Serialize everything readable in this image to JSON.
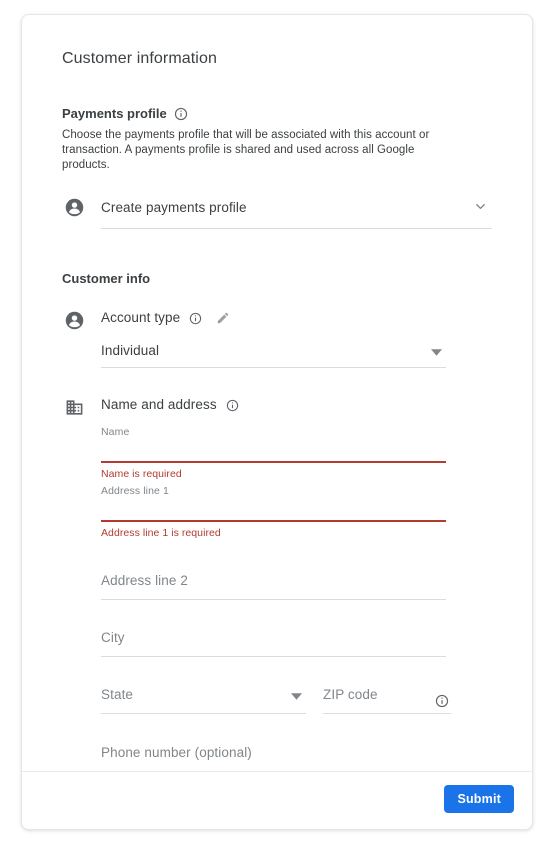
{
  "card": {
    "title": "Customer information",
    "payments_profile": {
      "heading": "Payments profile",
      "info_icon": "info-icon",
      "description": "Choose the payments profile that will be associated with this account or transaction. A payments profile is shared and used across all Google products.",
      "select": {
        "leading_icon": "account-circle-icon",
        "value": "Create payments profile",
        "chevron_icon": "chevron-down-icon"
      }
    },
    "customer_info": {
      "heading": "Customer info",
      "account_type": {
        "leading_icon": "account-circle-icon",
        "label": "Account type",
        "info_icon": "info-icon",
        "edit_icon": "pencil-icon",
        "value": "Individual",
        "dropdown_icon": "dropdown-arrow-icon"
      },
      "name_and_address": {
        "leading_icon": "building-icon",
        "label": "Name and address",
        "info_icon": "info-icon",
        "fields": {
          "name": {
            "label": "Name",
            "value": "",
            "error": "Name is required"
          },
          "address_line_1": {
            "label": "Address line 1",
            "value": "",
            "error": "Address line 1 is required"
          },
          "address_line_2": {
            "placeholder": "Address line 2",
            "value": ""
          },
          "city": {
            "placeholder": "City",
            "value": ""
          },
          "state": {
            "placeholder": "State",
            "value": "",
            "dropdown_icon": "dropdown-arrow-icon"
          },
          "zip_code": {
            "placeholder": "ZIP code",
            "value": "",
            "info_icon": "info-icon"
          },
          "phone_number": {
            "placeholder": "Phone number (optional)",
            "value": ""
          }
        }
      }
    },
    "footer": {
      "submit_label": "Submit"
    }
  },
  "colors": {
    "accent": "#1a73e8",
    "error": "#b23b32",
    "text_primary": "#3c4043",
    "text_secondary": "#80868b",
    "divider": "#dadce0"
  }
}
